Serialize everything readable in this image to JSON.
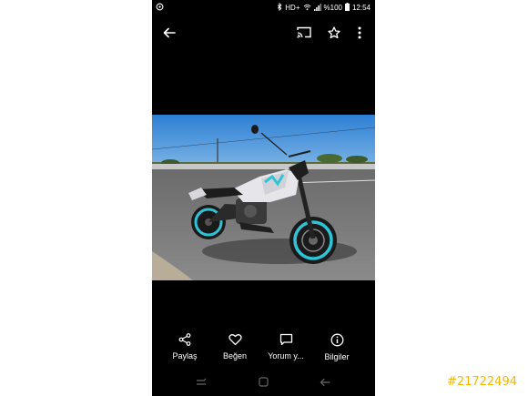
{
  "status": {
    "network": "HD+",
    "battery": "%100",
    "time": "12:54"
  },
  "icons": {
    "back": "arrow-left-icon",
    "cast": "cast-icon",
    "favorite": "star-icon",
    "more": "more-vert-icon"
  },
  "actions": [
    {
      "label": "Paylaş",
      "icon": "share-icon"
    },
    {
      "label": "Beğen",
      "icon": "heart-icon"
    },
    {
      "label": "Yorum y...",
      "icon": "comment-icon"
    },
    {
      "label": "Bilgiler",
      "icon": "info-icon"
    }
  ],
  "watermark": "#21722494",
  "colors": {
    "watermark": "#f5b800",
    "phone_bg": "#000000",
    "sky": "#2d7fd4",
    "accent_teal": "#2ec4d6"
  }
}
